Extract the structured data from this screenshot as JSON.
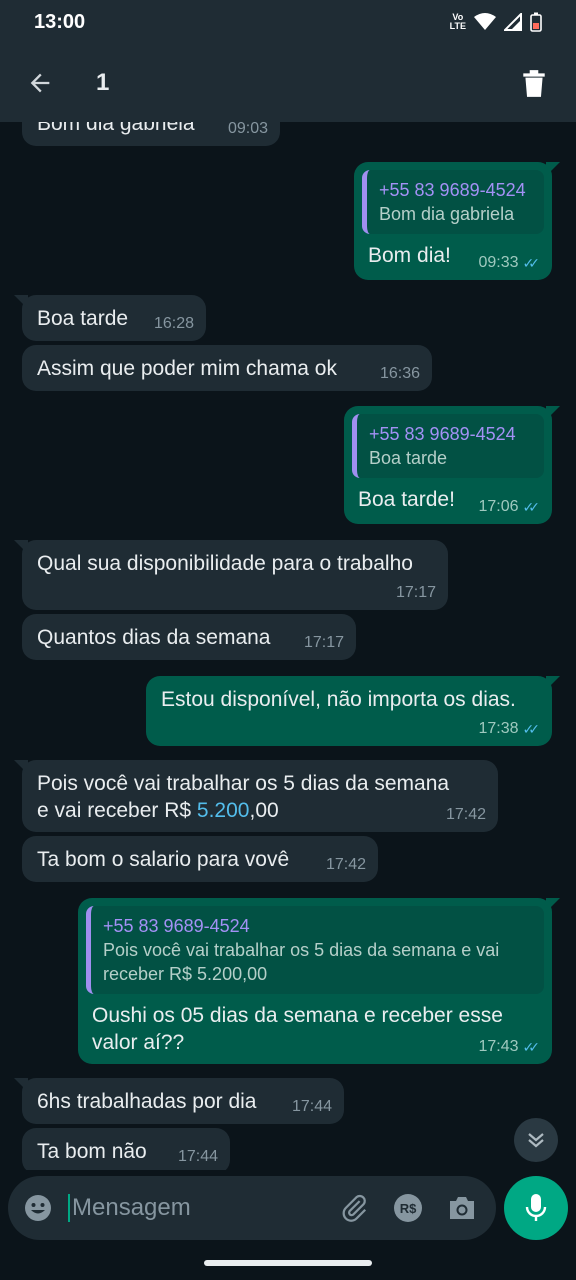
{
  "status": {
    "time": "13:00",
    "volte": "Vo\nLTE"
  },
  "header": {
    "selected_count": "1"
  },
  "messages": [
    {
      "dir": "in",
      "text": "Bom dia gabriela",
      "time": "09:03"
    },
    {
      "dir": "out",
      "quote_sender": "+55 83 9689-4524",
      "quote_text": "Bom dia gabriela",
      "text": "Bom dia!",
      "time": "09:33"
    },
    {
      "dir": "in",
      "text": "Boa tarde",
      "time": "16:28"
    },
    {
      "dir": "in",
      "text": "Assim que poder mim chama ok",
      "time": "16:36"
    },
    {
      "dir": "out",
      "quote_sender": "+55 83 9689-4524",
      "quote_text": "Boa tarde",
      "text": "Boa tarde!",
      "time": "17:06"
    },
    {
      "dir": "in",
      "text": "Qual sua disponibilidade para o trabalho",
      "time": "17:17"
    },
    {
      "dir": "in",
      "text": "Quantos dias da semana",
      "time": "17:17"
    },
    {
      "dir": "out",
      "text": "Estou disponível, não importa os dias.",
      "time": "17:38"
    },
    {
      "dir": "in",
      "text_a": "Pois você vai trabalhar os 5 dias da semana",
      "text_b_prefix": "e vai receber R$ ",
      "text_b_link": "5.200",
      "text_b_suffix": ",00",
      "time": "17:42"
    },
    {
      "dir": "in",
      "text": "Ta bom o salario para vovê",
      "time": "17:42"
    },
    {
      "dir": "out",
      "quote_sender": "+55 83 9689-4524",
      "quote_text_a": "Pois você vai trabalhar os 5 dias da semana e vai",
      "quote_text_b": "receber R$ 5.200,00",
      "text_a": "Oushi os 05 dias da semana e receber esse",
      "text_b": "valor aí??",
      "time": "17:43"
    },
    {
      "dir": "in",
      "text": "6hs trabalhadas por dia",
      "time": "17:44"
    },
    {
      "dir": "in",
      "text": "Ta bom não",
      "time": "17:44"
    }
  ],
  "composer": {
    "placeholder": "Mensagem",
    "currency_icon_label": "R$"
  },
  "colors": {
    "incoming": "#1f2c34",
    "outgoing": "#005c4b",
    "accent": "#00a884",
    "read_ticks": "#53bdeb"
  },
  "icons": [
    "back-arrow-icon",
    "trash-icon",
    "chevron-double-down-icon",
    "emoji-icon",
    "attach-icon",
    "pix-currency-icon",
    "camera-icon",
    "mic-icon"
  ]
}
